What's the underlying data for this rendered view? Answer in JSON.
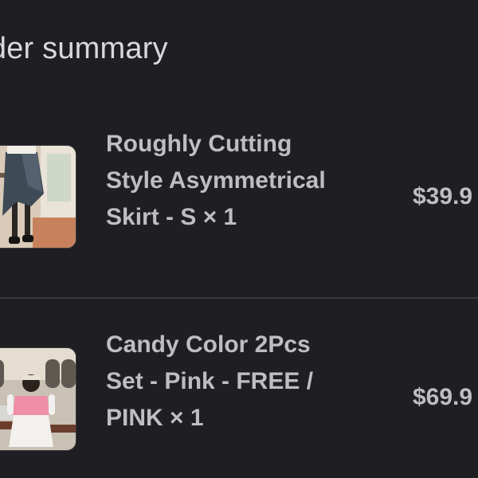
{
  "order_summary": {
    "title": "rder summary",
    "items": [
      {
        "name": "Roughly Cutting\nStyle Asymmetrical\nSkirt - S × 1",
        "price": "$39.9",
        "image_icon": "skirt-product-photo"
      },
      {
        "name": "Candy Color 2Pcs\nSet - Pink - FREE /\nPINK × 1",
        "price": "$69.9",
        "image_icon": "pink-set-product-photo"
      }
    ]
  },
  "colors": {
    "background": "#1f1f23",
    "text": "#bebec2",
    "divider": "#38383e"
  }
}
